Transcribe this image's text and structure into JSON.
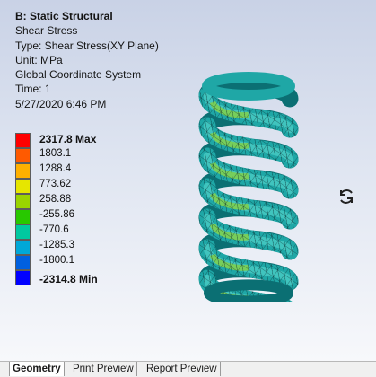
{
  "info": {
    "title": "B: Static Structural",
    "lines": [
      "Shear Stress",
      "Type: Shear Stress(XY Plane)",
      "Unit: MPa",
      "Global Coordinate System",
      "Time: 1",
      "5/27/2020 6:46 PM"
    ]
  },
  "legend": {
    "labels": [
      "2317.8 Max",
      "1803.1",
      "1288.4",
      "773.62",
      "258.88",
      "-255.86",
      "-770.6",
      "-1285.3",
      "-1800.1",
      "-2314.8 Min"
    ],
    "colors": [
      "#ff0000",
      "#ff5a00",
      "#ffb000",
      "#e6e600",
      "#9ad400",
      "#28c800",
      "#00c8a0",
      "#00a8d8",
      "#0060e0",
      "#0000ff"
    ]
  },
  "model": {
    "colors": {
      "tube": "#1fa7a6",
      "tube_light": "#4fd0c9",
      "tube_dark": "#0b6f73",
      "hot": "#8ad23a",
      "mesh": "#06262a"
    }
  },
  "tabs": [
    "Geometry",
    "Print Preview",
    "Report Preview"
  ],
  "icons": {
    "rotate": "rotate-icon"
  }
}
